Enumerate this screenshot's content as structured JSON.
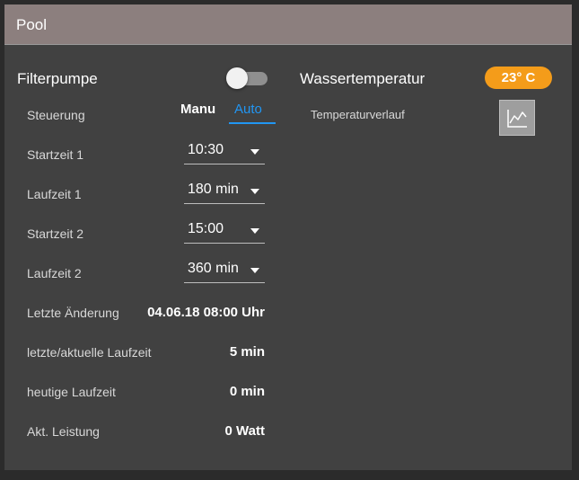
{
  "card": {
    "title": "Pool"
  },
  "filterpumpe": {
    "title": "Filterpumpe",
    "toggle_on": false,
    "steuerung": {
      "label": "Steuerung",
      "mode_manu": "Manu",
      "mode_auto": "Auto",
      "active": "Auto"
    },
    "startzeit1": {
      "label": "Startzeit 1",
      "value": "10:30"
    },
    "laufzeit1": {
      "label": "Laufzeit 1",
      "value": "180 min"
    },
    "startzeit2": {
      "label": "Startzeit 2",
      "value": "15:00"
    },
    "laufzeit2": {
      "label": "Laufzeit 2",
      "value": "360 min"
    },
    "letzte_aenderung": {
      "label": "Letzte Änderung",
      "value": "04.06.18 08:00 Uhr"
    },
    "aktuelle_laufzeit": {
      "label": "letzte/aktuelle Laufzeit",
      "value": "5 min"
    },
    "heutige_laufzeit": {
      "label": "heutige Laufzeit",
      "value": "0 min"
    },
    "leistung": {
      "label": "Akt. Leistung",
      "value": "0 Watt"
    }
  },
  "wassertemperatur": {
    "title": "Wassertemperatur",
    "badge": "23° C",
    "badge_color": "#f49c1a",
    "verlauf_label": "Temperaturverlauf",
    "chart_icon": "line-chart-icon"
  },
  "colors": {
    "accent": "#2196f3",
    "header": "#8c7f7e",
    "panel": "#414141"
  }
}
